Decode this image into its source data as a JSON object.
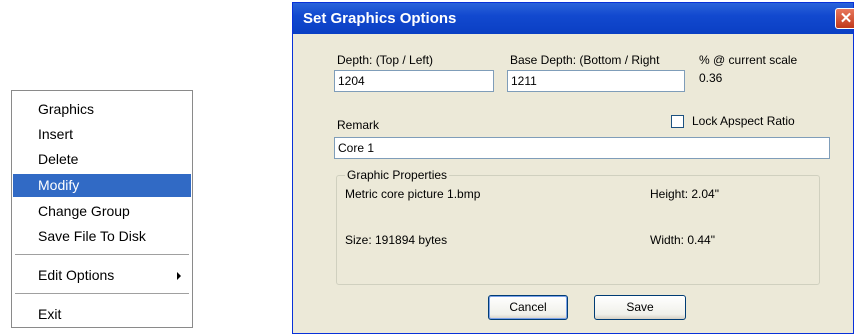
{
  "context_menu": {
    "items": [
      {
        "label": "Graphics"
      },
      {
        "label": "Insert"
      },
      {
        "label": "Delete"
      },
      {
        "label": "Modify",
        "selected": true
      },
      {
        "label": "Change Group"
      },
      {
        "label": "Save File To Disk"
      },
      {
        "label": "Edit Options",
        "has_submenu": true
      },
      {
        "label": "Exit"
      }
    ]
  },
  "dialog": {
    "title": "Set Graphics Options",
    "close_icon": "close-icon",
    "depth_top": {
      "label": "Depth: (Top / Left)",
      "value": "1204"
    },
    "depth_base": {
      "label": "Base Depth: (Bottom / Right",
      "value": "1211"
    },
    "scale": {
      "label": "% @ current scale",
      "value": "0.36"
    },
    "remark": {
      "label": "Remark",
      "value": "Core 1"
    },
    "lock_aspect": {
      "label": "Lock Apspect Ratio",
      "checked": false
    },
    "graphic_properties": {
      "legend": "Graphic Properties",
      "filename": "Metric core picture 1.bmp",
      "height": "Height: 2.04\"",
      "size": "Size: 191894 bytes",
      "width": "Width: 0.44\""
    },
    "buttons": {
      "cancel": "Cancel",
      "save": "Save"
    }
  },
  "colors": {
    "selection": "#316ac5",
    "dialog_face": "#ece9d8",
    "titlebar": "#0a3fc4",
    "close_button": "#c0391b"
  }
}
